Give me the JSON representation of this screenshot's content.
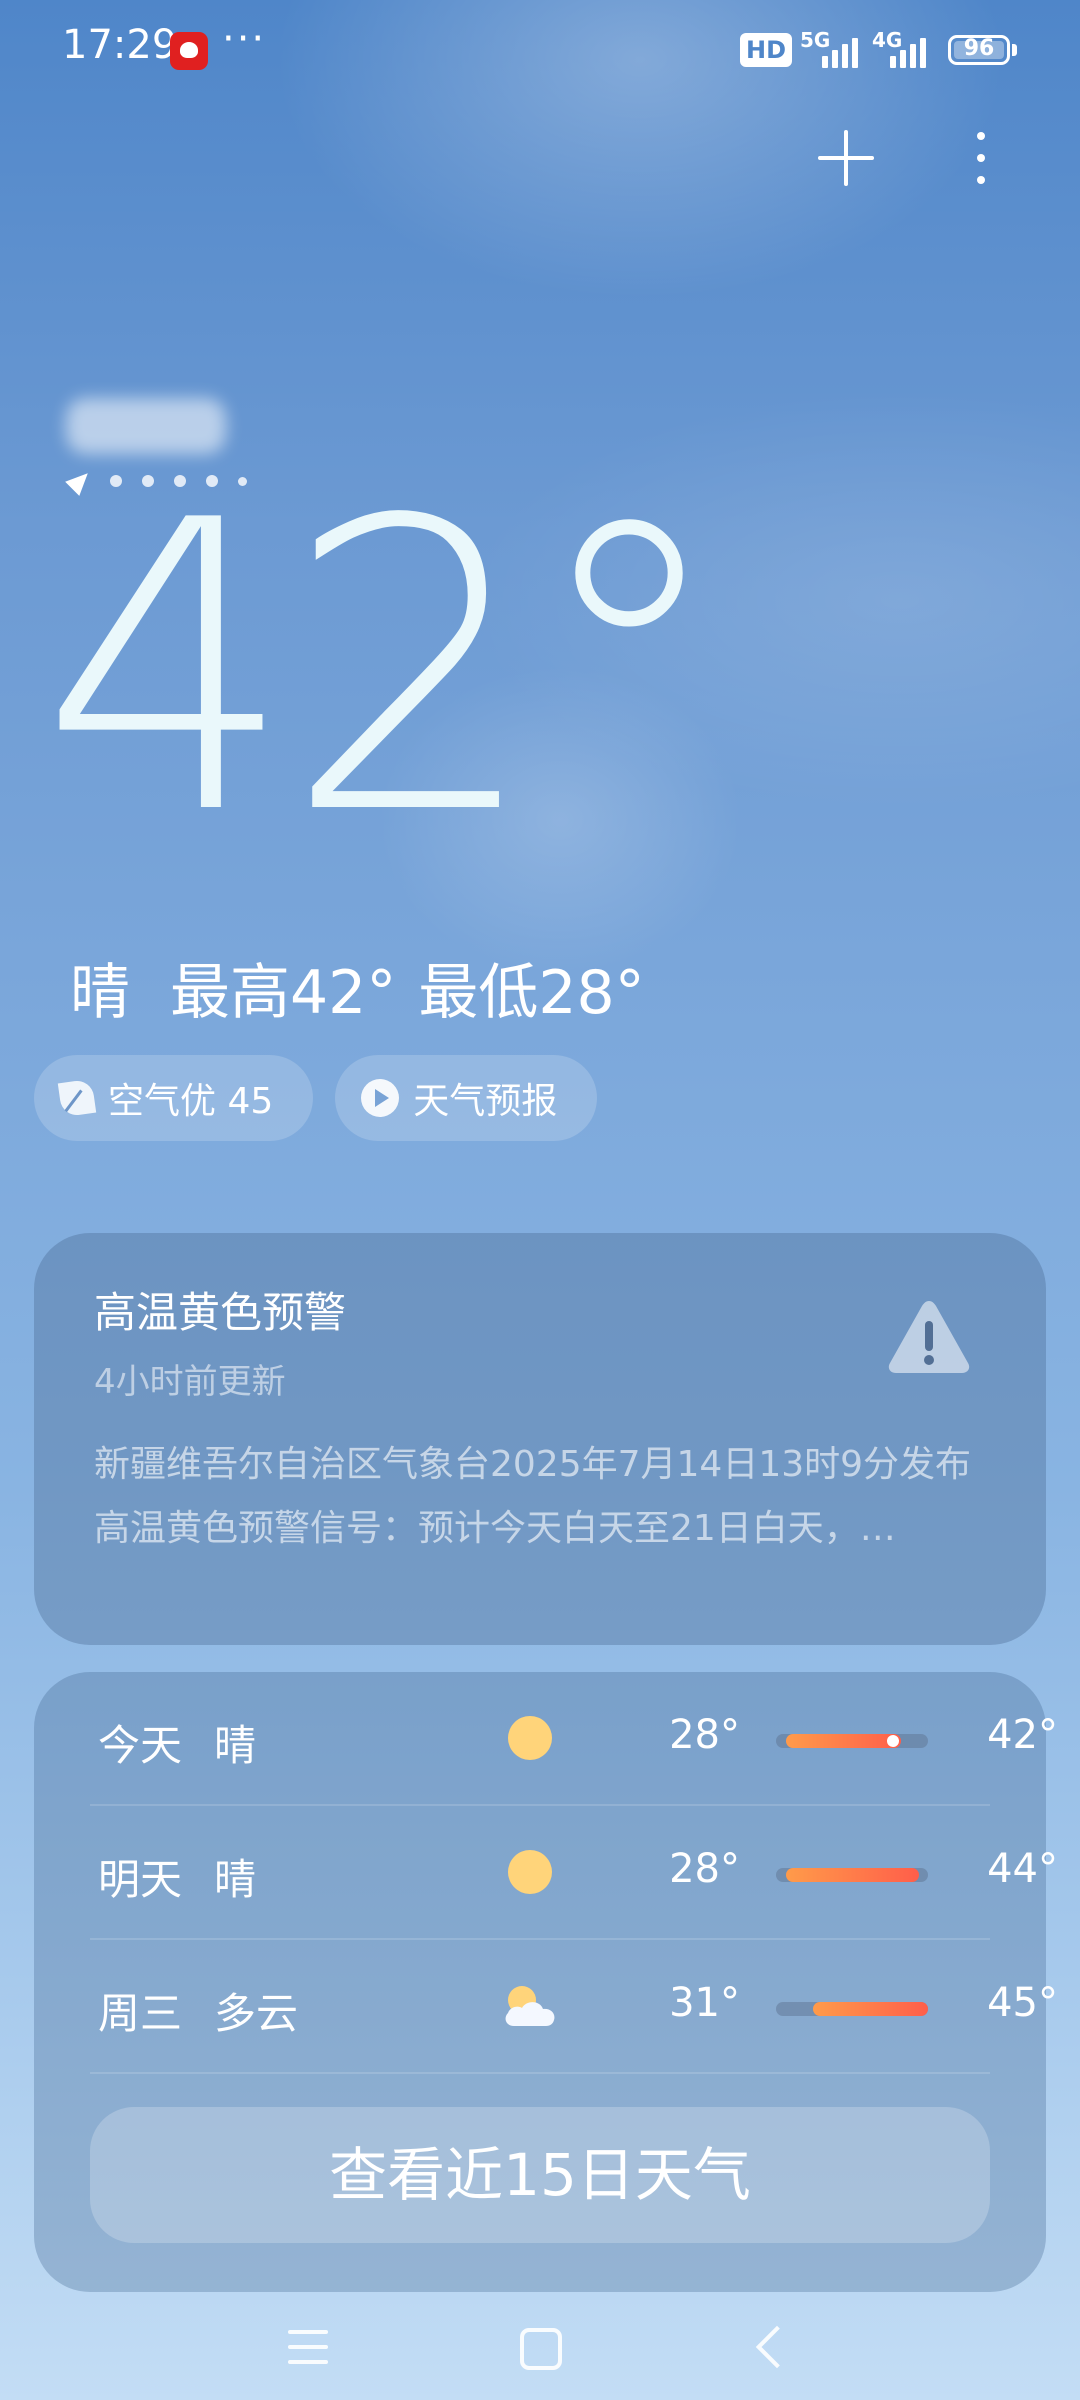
{
  "status_bar": {
    "time": "17:29",
    "more": "···",
    "hd_badge": "HD",
    "network_1": "5G",
    "network_2": "4G",
    "battery": "96"
  },
  "location": {
    "page_count": 6,
    "active_page": 0
  },
  "current": {
    "temperature": "42°",
    "condition": "晴",
    "high": "最高42°",
    "low": "最低28°"
  },
  "chips": {
    "air_quality": "空气优 45",
    "forecast_video": "天气预报"
  },
  "alert": {
    "title": "高温黄色预警",
    "updated": "4小时前更新",
    "description": "新疆维吾尔自治区气象台2025年7月14日13时9分发布高温黄色预警信号：预计今天白天至21日白天，…"
  },
  "forecast": {
    "range_min": 28,
    "range_max": 45,
    "days": [
      {
        "day": "今天",
        "condition": "晴",
        "icon": "sun-icon",
        "low": "28°",
        "high": "42°",
        "low_value": 28,
        "high_value": 42,
        "current_value": 42
      },
      {
        "day": "明天",
        "condition": "晴",
        "icon": "sun-icon",
        "low": "28°",
        "high": "44°",
        "low_value": 28,
        "high_value": 44
      },
      {
        "day": "周三",
        "condition": "多云",
        "icon": "partly-cloudy-icon",
        "low": "31°",
        "high": "45°",
        "low_value": 31,
        "high_value": 45
      }
    ],
    "more_button": "查看近15日天气"
  },
  "colors": {
    "sky_top": "#4f86c9",
    "sky_bottom": "#c3ddf5",
    "sun": "#ffd47a",
    "bar_start": "#ff9b4a",
    "bar_end": "#ff5e4a"
  }
}
